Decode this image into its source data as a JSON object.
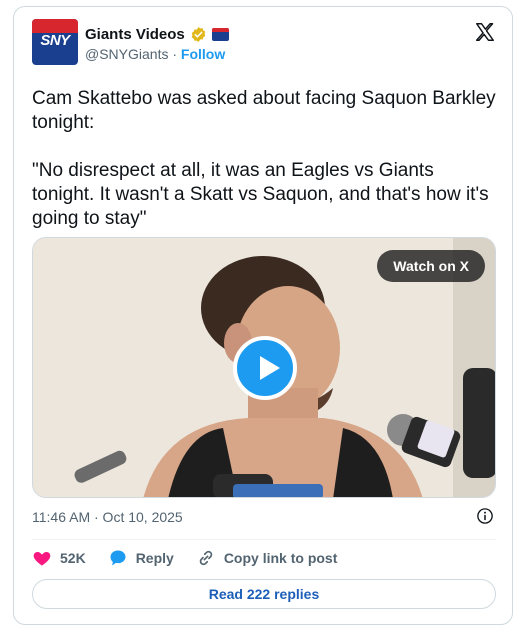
{
  "account": {
    "display_name": "Giants Videos",
    "avatar_text": "SNY",
    "handle": "@SNYGiants",
    "separator": "·",
    "follow_label": "Follow"
  },
  "tweet": {
    "text": "Cam Skattebo was asked about facing Saquon Barkley tonight:\n\n\"No disrespect at all, it was an Eagles vs Giants tonight. It wasn't a Skatt vs Saquon, and that's how it's going to stay\""
  },
  "media": {
    "watch_label": "Watch on X",
    "icon": "play-icon"
  },
  "meta": {
    "timestamp": "11:46 AM · Oct 10, 2025"
  },
  "actions": {
    "like_count": "52K",
    "reply_label": "Reply",
    "copy_label": "Copy link to post"
  },
  "footer": {
    "read_replies_label": "Read 222 replies"
  },
  "colors": {
    "accent": "#1d9bf0",
    "like": "#f91880",
    "brand_blue": "#1b3f8f",
    "brand_red": "#d7262d"
  }
}
